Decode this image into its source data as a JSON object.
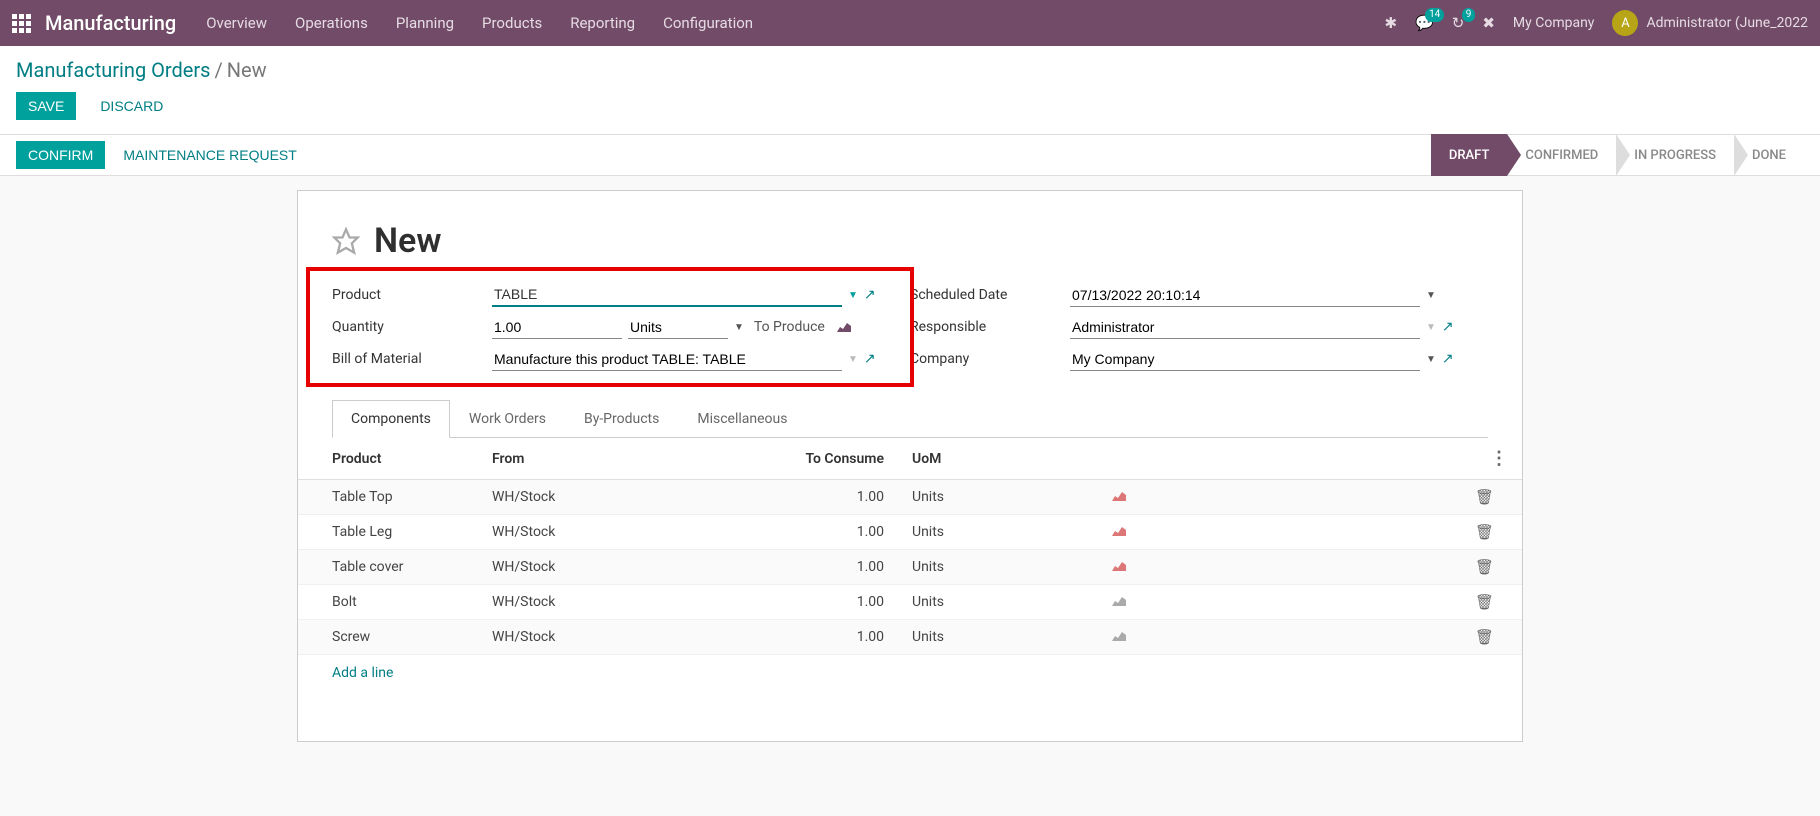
{
  "topbar": {
    "brand": "Manufacturing",
    "nav": [
      "Overview",
      "Operations",
      "Planning",
      "Products",
      "Reporting",
      "Configuration"
    ],
    "messages_badge": "14",
    "activities_badge": "9",
    "company": "My Company",
    "avatar_letter": "A",
    "user": "Administrator (June_2022"
  },
  "breadcrumb": {
    "parent": "Manufacturing Orders",
    "current": "New"
  },
  "actions": {
    "save": "SAVE",
    "discard": "DISCARD"
  },
  "statusbar": {
    "left": [
      "CONFIRM",
      "MAINTENANCE REQUEST"
    ],
    "right": [
      "DRAFT",
      "CONFIRMED",
      "IN PROGRESS",
      "DONE"
    ],
    "active": "DRAFT"
  },
  "title": "New",
  "form": {
    "product_label": "Product",
    "product_value": "TABLE",
    "quantity_label": "Quantity",
    "quantity_value": "1.00",
    "quantity_uom": "Units",
    "to_produce": "To Produce",
    "bom_label": "Bill of Material",
    "bom_value": "Manufacture this product TABLE: TABLE",
    "scheduled_label": "Scheduled Date",
    "scheduled_value": "07/13/2022 20:10:14",
    "responsible_label": "Responsible",
    "responsible_value": "Administrator",
    "company_label": "Company",
    "company_value": "My Company"
  },
  "tabs": [
    "Components",
    "Work Orders",
    "By-Products",
    "Miscellaneous"
  ],
  "active_tab": "Components",
  "columns": {
    "product": "Product",
    "from": "From",
    "to_consume": "To Consume",
    "uom": "UoM"
  },
  "rows": [
    {
      "product": "Table Top",
      "from": "WH/Stock",
      "qty": "1.00",
      "uom": "Units",
      "red": true
    },
    {
      "product": "Table Leg",
      "from": "WH/Stock",
      "qty": "1.00",
      "uom": "Units",
      "red": true
    },
    {
      "product": "Table cover",
      "from": "WH/Stock",
      "qty": "1.00",
      "uom": "Units",
      "red": true
    },
    {
      "product": "Bolt",
      "from": "WH/Stock",
      "qty": "1.00",
      "uom": "Units",
      "red": false
    },
    {
      "product": "Screw",
      "from": "WH/Stock",
      "qty": "1.00",
      "uom": "Units",
      "red": false
    }
  ],
  "add_line": "Add a line"
}
